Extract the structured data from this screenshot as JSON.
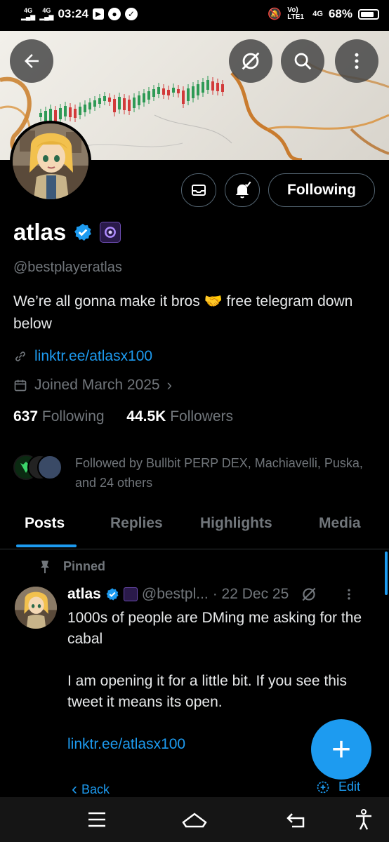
{
  "status_bar": {
    "signal_1": "4G",
    "signal_2": "4G",
    "time": "03:24",
    "carrier": "Vo) LTE1",
    "network": "4G",
    "battery": "68%"
  },
  "header": {
    "back_icon": "arrow-left-icon",
    "grok_icon": "grok-icon",
    "search_icon": "search-icon",
    "more_icon": "more-vertical-icon"
  },
  "profile": {
    "name": "atlas",
    "handle": "@bestplayeratlas",
    "bio": "We’re all gonna make it bros 🤝 free telegram down below",
    "link": "linktr.ee/atlasx100",
    "joined": "Joined March 2025",
    "following_count": "637",
    "following_label": "Following",
    "followers_count": "44.5K",
    "followers_label": "Followers",
    "followed_by": "Followed by Bullbit PERP DEX, Machiavelli, Puska, and 24 others",
    "follow_button": "Following"
  },
  "tabs": [
    {
      "label": "Posts"
    },
    {
      "label": "Replies"
    },
    {
      "label": "Highlights"
    },
    {
      "label": "Media"
    }
  ],
  "tweet": {
    "pinned_label": "Pinned",
    "author": "atlas",
    "handle": "@bestpl...",
    "date": "· 22 Dec 25",
    "line1": "1000s of people are DMing me asking for the cabal",
    "line2": "I am opening it for a little bit. If you see this tweet it means its open.",
    "link": "linktr.ee/atlasx100"
  },
  "overlay": {
    "back_label": "Back",
    "edit_label": "Edit",
    "fab_label": "+"
  },
  "colors": {
    "accent": "#1d9bf0",
    "background": "#000000",
    "muted": "#71767b"
  }
}
